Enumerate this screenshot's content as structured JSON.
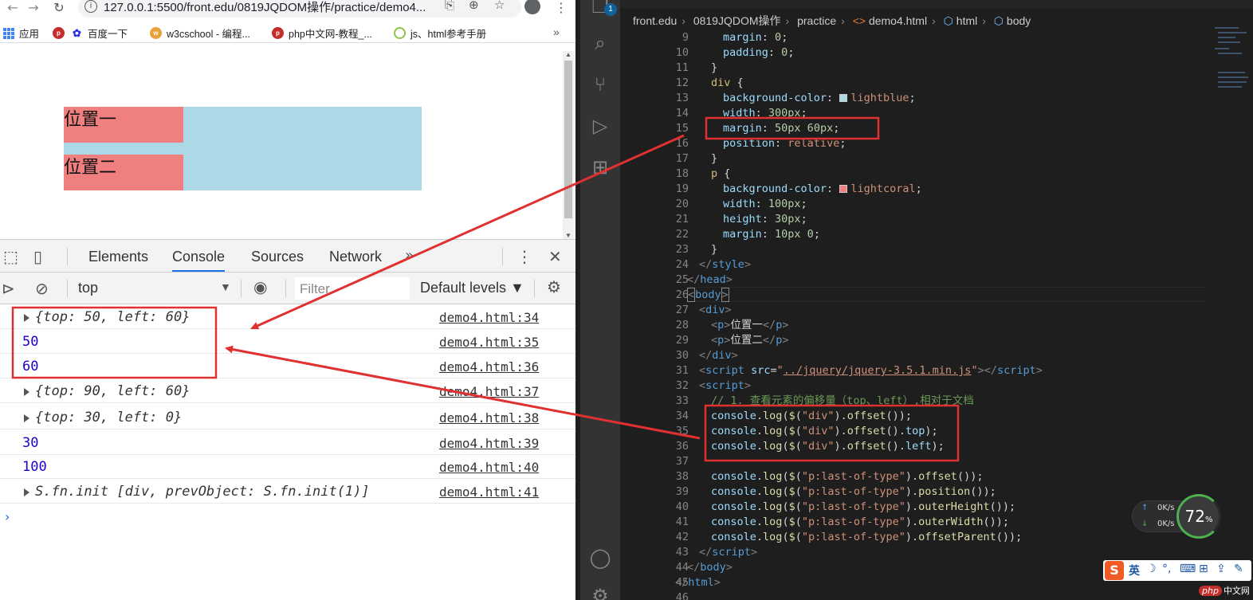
{
  "browser": {
    "url": "127.0.0.1:5500/front.edu/0819JQDOM操作/practice/demo4...",
    "bookmarks": [
      {
        "label": "应用"
      },
      {
        "label": "百度一下"
      },
      {
        "label": "w3cschool - 编程..."
      },
      {
        "label": "php中文网-教程_..."
      },
      {
        "label": "js、html参考手册"
      }
    ],
    "page": {
      "p1": "位置一",
      "p2": "位置二"
    }
  },
  "devtools": {
    "tabs": [
      "Elements",
      "Console",
      "Sources",
      "Network"
    ],
    "active_tab": "Console",
    "context": "top",
    "filter_placeholder": "Filter",
    "levels": "Default levels ▼",
    "logs": [
      {
        "msg": "{top: 50, left: 60}",
        "src": "demo4.html:34"
      },
      {
        "msg": "50",
        "src": "demo4.html:35"
      },
      {
        "msg": "60",
        "src": "demo4.html:36"
      },
      {
        "msg": "{top: 90, left: 60}",
        "src": "demo4.html:37"
      },
      {
        "msg": "{top: 30, left: 0}",
        "src": "demo4.html:38"
      },
      {
        "msg": "30",
        "src": "demo4.html:39"
      },
      {
        "msg": "100",
        "src": "demo4.html:40"
      },
      {
        "msg": "S.fn.init [div, prevObject: S.fn.init(1)]",
        "src": "demo4.html:41"
      }
    ],
    "prompt": "›"
  },
  "editor": {
    "activity_badge": "1",
    "breadcrumbs": [
      "front.edu",
      "0819JQDOM操作",
      "practice",
      "demo4.html",
      "html",
      "body"
    ],
    "line_numbers": [
      "9",
      "10",
      "11",
      "12",
      "13",
      "14",
      "15",
      "16",
      "17",
      "18",
      "19",
      "20",
      "21",
      "22",
      "23",
      "24",
      "25",
      "26",
      "27",
      "28",
      "29",
      "30",
      "31",
      "32",
      "33",
      "34",
      "35",
      "36",
      "37",
      "38",
      "39",
      "40",
      "41",
      "42",
      "43",
      "44",
      "45",
      "46"
    ]
  },
  "widgets": {
    "net_up": "0K/s",
    "net_down": "0K/s",
    "cpu": "72",
    "cpu_unit": "%",
    "ime_lang": "英",
    "watermark": "中文网"
  },
  "colors": {
    "lightblue": "#add8e6",
    "lightcoral": "#f08080",
    "annotation_red": "#e03131"
  }
}
